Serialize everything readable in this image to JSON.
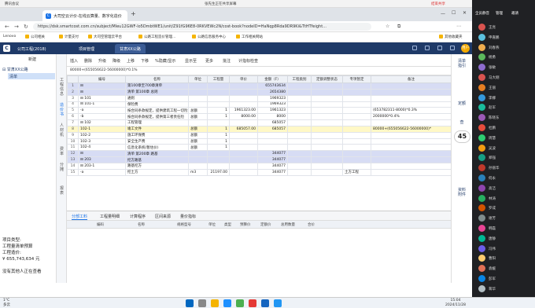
{
  "meeting_bar": {
    "left": "腾讯会议",
    "center": "张先生正在共享屏幕",
    "right": "结束共享"
  },
  "browser": {
    "tabs": [
      {
        "label": "大司空云计价-在线云算量、数字化造价",
        "icon": "C",
        "active": true
      }
    ],
    "new_tab": "+",
    "url": "https://dsk.smartcost.com.cn/subject/Mleu12GWF-lo5DmbtWE1/unit/Z91fG96E8-0RKVEWc2N/cost-book?nodeID=HaNqp8Rda9DR9Ki&TtHTfeight...",
    "bookmarks": [
      "Lenovo",
      "公司相关",
      "计量支付",
      "大司空管理云平台",
      "公路工程造价管理...",
      "公路信息服务中心",
      "工作相关网站",
      "其他收藏夹"
    ]
  },
  "app": {
    "tabs": [
      {
        "label": "公司工程(2018)",
        "active": false
      },
      {
        "label": "项目管理",
        "active": false
      },
      {
        "label": "甘肃XX公路",
        "active": true
      }
    ],
    "user_avatar": "用户"
  },
  "left_panel": {
    "header_new": "新建",
    "tree_root": "甘肃XX公路",
    "tree_selected": "清单",
    "project_type_label": "项目类型:",
    "project_type_value": "工程量清单预算",
    "cost_label": "工程造价:",
    "cost_value": "¥ 655,743,634 元",
    "viewers": "没有其他人正在查看"
  },
  "side_tabs": [
    "工程信息",
    "造价书",
    "人材机",
    "费率",
    "分摊",
    "报表"
  ],
  "toolbar": {
    "items": [
      "插入",
      "删除",
      "升级",
      "降级",
      "上移",
      "下移",
      "%隐藏/显示",
      "显示至",
      "更多",
      "批注",
      "计指标检查"
    ],
    "formula": "80000+(655056622-56000000)*0.1%"
  },
  "grid": {
    "headers": [
      "",
      "编号",
      "名称",
      "单位",
      "工程量",
      "单价",
      "金额（F）",
      "工程类别",
      "定额调整状态",
      "专项暂定",
      "备注"
    ],
    "rows": [
      {
        "n": "1",
        "code": "⊟",
        "name": "第100章至700章清单",
        "unit": "",
        "qty": "",
        "price": "",
        "amount": "655743634",
        "note": "",
        "style": "blue"
      },
      {
        "n": "2",
        "code": "⊟",
        "name": "清单 第100章 总则",
        "unit": "",
        "qty": "",
        "price": "",
        "amount": "2654380",
        "note": "",
        "style": "blue"
      },
      {
        "n": "3",
        "code": "⊟ 101",
        "name": "通则",
        "unit": "",
        "qty": "",
        "price": "",
        "amount": "1969323",
        "note": "",
        "style": ""
      },
      {
        "n": "4",
        "code": "⊟ 101-1",
        "name": "保险费",
        "unit": "",
        "qty": "",
        "price": "",
        "amount": "1969323",
        "note": "",
        "style": ""
      },
      {
        "n": "5",
        "code": "-a",
        "name": "按合同条款规定，提供建筑工程一切险",
        "unit": "总额",
        "qty": "1",
        "price": "1961323.00",
        "amount": "1961323",
        "note": "(653782311-8000)*0.3%",
        "style": ""
      },
      {
        "n": "6",
        "code": "-b",
        "name": "按合同条款规定，提供第三者责任险",
        "unit": "总额",
        "qty": "1",
        "price": "8000.00",
        "amount": "8000",
        "note": "2000000*0.4%",
        "style": ""
      },
      {
        "n": "7",
        "code": "⊟ 102",
        "name": "工程管理",
        "unit": "",
        "qty": "",
        "price": "",
        "amount": "685057",
        "note": "",
        "style": ""
      },
      {
        "n": "8",
        "code": "102-1",
        "name": "竣工文件",
        "unit": "总额",
        "qty": "1",
        "price": "685057.00",
        "amount": "685057",
        "note": "80000+(655056622-56000000)*",
        "style": "sel"
      },
      {
        "n": "9",
        "code": "102-2",
        "name": "施工环保费",
        "unit": "总额",
        "qty": "1",
        "price": "",
        "amount": "",
        "note": "",
        "style": ""
      },
      {
        "n": "10",
        "code": "102-3",
        "name": "安全生产费",
        "unit": "总额",
        "qty": "1",
        "price": "",
        "amount": "",
        "note": "",
        "style": ""
      },
      {
        "n": "11",
        "code": "102-4",
        "name": "信息化系统(暂估价)",
        "unit": "总额",
        "qty": "1",
        "price": "",
        "amount": "",
        "note": "",
        "style": ""
      },
      {
        "n": "12",
        "code": "⊟",
        "name": "清单 第200章 路基",
        "unit": "",
        "qty": "",
        "price": "",
        "amount": "344077",
        "note": "",
        "style": "blue"
      },
      {
        "n": "13",
        "code": "⊟ 203",
        "name": "挖方路基",
        "unit": "",
        "qty": "",
        "price": "",
        "amount": "344077",
        "note": "",
        "style": "blue"
      },
      {
        "n": "14",
        "code": "⊟ 203-1",
        "name": "路基挖方",
        "unit": "",
        "qty": "",
        "price": "",
        "amount": "344077",
        "note": "",
        "style": ""
      },
      {
        "n": "15",
        "code": "-a",
        "name": "挖土方",
        "unit": "m3",
        "qty": "21197.00",
        "price": "",
        "amount": "344077",
        "note": "",
        "style": ""
      }
    ],
    "row15_category": "土方工程"
  },
  "bottom_tabs": [
    {
      "label": "分部工料",
      "active": true
    },
    {
      "label": "工程量明细",
      "active": false
    },
    {
      "label": "计算程序",
      "active": false
    },
    {
      "label": "区间来源",
      "active": false
    },
    {
      "label": "量价指标",
      "active": false
    }
  ],
  "bottom_headers": [
    "编码",
    "名称",
    "规格型号",
    "单位",
    "类型",
    "预算价",
    "定额价",
    "总用数量",
    "合价"
  ],
  "right_tabs": [
    "清单指引",
    "定额",
    "查",
    "资料附件"
  ],
  "zoom": "45",
  "participants": [
    {
      "name": "王亮",
      "color": "#d9534f"
    },
    {
      "name": "申嘉鹏",
      "color": "#5bc0de"
    },
    {
      "name": "刘春燕",
      "color": "#f0ad4e"
    },
    {
      "name": "杨勇",
      "color": "#5cb85c"
    },
    {
      "name": "张敏",
      "color": "#8e6ccf"
    },
    {
      "name": "马大刚",
      "color": "#d9534f"
    },
    {
      "name": "王丽",
      "color": "#e67e22"
    },
    {
      "name": "李娜",
      "color": "#3498db"
    },
    {
      "name": "赵军",
      "color": "#1abc9c"
    },
    {
      "name": "陈晓东",
      "color": "#9b59b6"
    },
    {
      "name": "杜鹏",
      "color": "#e74c3c"
    },
    {
      "name": "周慧",
      "color": "#2ecc71"
    },
    {
      "name": "吴波",
      "color": "#f39c12"
    },
    {
      "name": "郑强",
      "color": "#16a085"
    },
    {
      "name": "孙丽华",
      "color": "#c0392b"
    },
    {
      "name": "何永",
      "color": "#2980b9"
    },
    {
      "name": "高洁",
      "color": "#8e44ad"
    },
    {
      "name": "林涛",
      "color": "#27ae60"
    },
    {
      "name": "罗成",
      "color": "#d35400"
    },
    {
      "name": "谢芳",
      "color": "#7f8c8d"
    },
    {
      "name": "韩磊",
      "color": "#e84393"
    },
    {
      "name": "唐静",
      "color": "#00b894"
    },
    {
      "name": "冯伟",
      "color": "#6c5ce7"
    },
    {
      "name": "曹阳",
      "color": "#fdcb6e"
    },
    {
      "name": "袁媛",
      "color": "#e17055"
    },
    {
      "name": "彭军",
      "color": "#0984e3"
    },
    {
      "name": "蒋华",
      "color": "#b2bec3"
    }
  ],
  "participant_header": [
    "全员静音",
    "管理",
    "邀请"
  ],
  "taskbar": {
    "weather_temp": "1°C",
    "weather_desc": "多云",
    "time": "15:04",
    "date": "2024/11/28"
  }
}
